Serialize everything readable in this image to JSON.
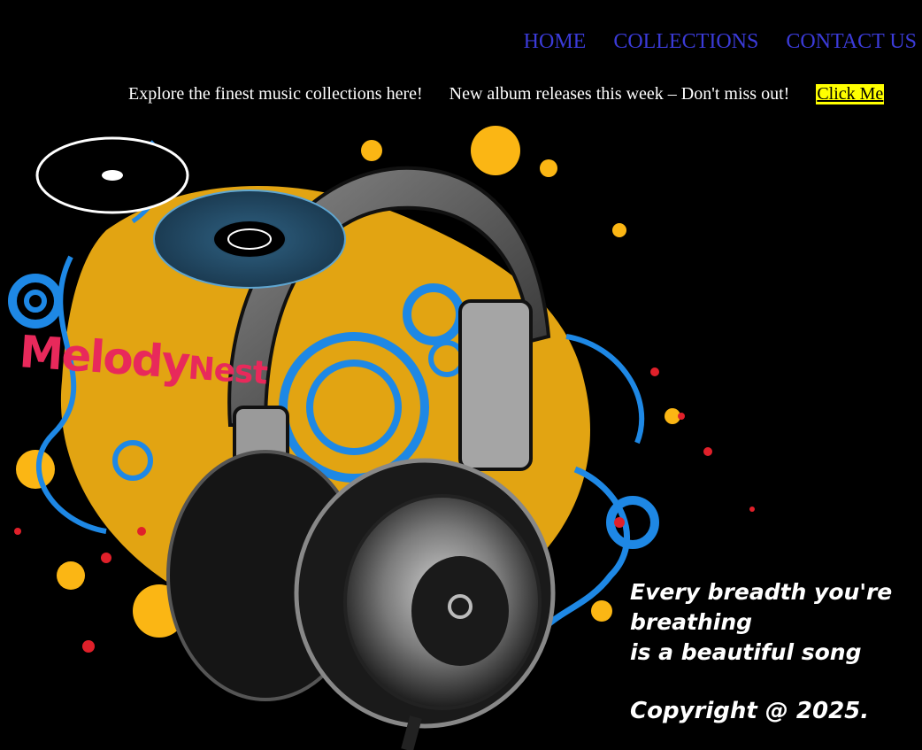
{
  "nav": {
    "home": "HOME",
    "collections": "COLLECTIONS",
    "contact": "CONTACT US"
  },
  "ticker": {
    "message_1": "Explore the finest music collections here!",
    "message_2": "New album releases this week – Don't miss out!",
    "button_label": "Click Me"
  },
  "logo": {
    "word_1": "Melody",
    "word_2": "Nest"
  },
  "quote": {
    "line_1": "Every breadth you're breathing",
    "line_2": "is a beautiful song"
  },
  "footer": {
    "copyright": "Copyright @ 2025."
  },
  "colors": {
    "nav_link": "#3b3bd8",
    "button_bg": "#ffff00",
    "logo": "#e8295b",
    "splash_yellow": "#fbb614",
    "swirl_blue": "#1e88e5"
  }
}
